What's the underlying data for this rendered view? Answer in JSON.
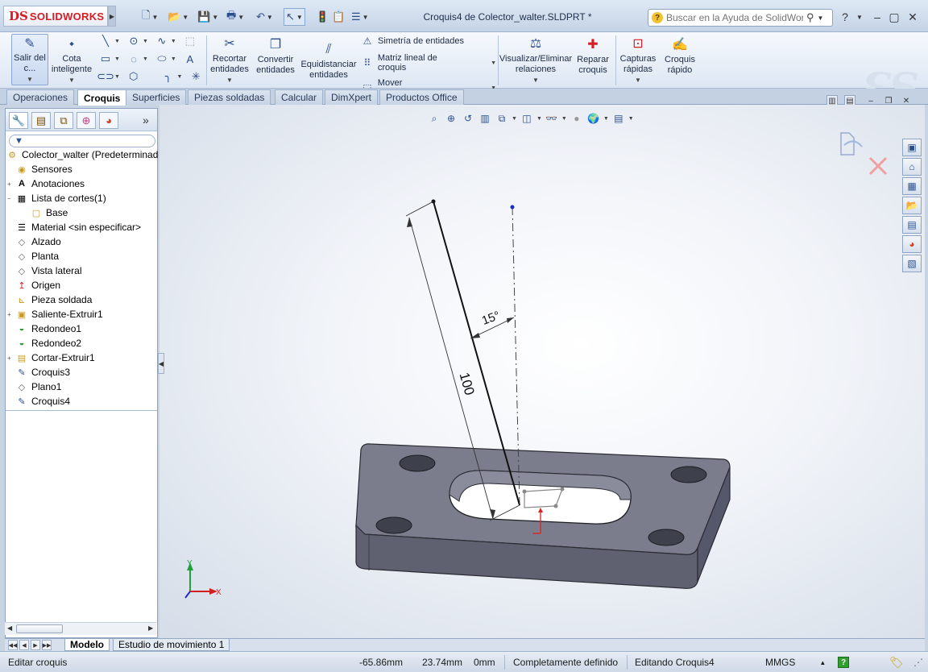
{
  "app": {
    "logo_symbol": "DS",
    "logo_text": "SOLIDWORKS",
    "document_title": "Croquis4 de Colector_walter.SLDPRT *",
    "search_placeholder": "Buscar en la Ayuda de SolidWorks"
  },
  "quick_access": [
    "new-icon",
    "open-icon",
    "save-icon",
    "print-icon",
    "undo-icon",
    "select-icon",
    "rebuild-icon",
    "file-properties-icon",
    "options-icon"
  ],
  "command_manager": {
    "exit_sketch": "Salir del c...",
    "smart_dimension": "Cota inteligente",
    "trim_entities": "Recortar entidades",
    "convert_entities": "Convertir entidades",
    "offset_entities": "Equidistanciar entidades",
    "mirror_entities": "Simetría de entidades",
    "linear_pattern": "Matriz lineal de croquis",
    "move_entities": "Mover entidades",
    "display_relations": "Visualizar/Eliminar relaciones",
    "repair_sketch": "Reparar croquis",
    "quick_snaps": "Capturas rápidas",
    "rapid_sketch": "Croquis rápido"
  },
  "tabs": [
    {
      "label": "Operaciones",
      "active": false
    },
    {
      "label": "Croquis",
      "active": true
    },
    {
      "label": "Superficies",
      "active": false
    },
    {
      "label": "Piezas soldadas",
      "active": false
    },
    {
      "label": "Calcular",
      "active": false
    },
    {
      "label": "DimXpert",
      "active": false
    },
    {
      "label": "Productos Office",
      "active": false
    }
  ],
  "tree": {
    "root": "Colector_walter  (Predeterminado",
    "items": [
      {
        "label": "Sensores",
        "icon": "sensor-icon"
      },
      {
        "label": "Anotaciones",
        "icon": "annotation-icon"
      },
      {
        "label": "Lista de cortes(1)",
        "icon": "cutlist-icon"
      },
      {
        "label": "Base",
        "icon": "body-icon"
      },
      {
        "label": "Material <sin especificar>",
        "icon": "material-icon"
      },
      {
        "label": "Alzado",
        "icon": "plane-icon"
      },
      {
        "label": "Planta",
        "icon": "plane-icon"
      },
      {
        "label": "Vista lateral",
        "icon": "plane-icon"
      },
      {
        "label": "Origen",
        "icon": "origin-icon"
      },
      {
        "label": "Pieza soldada",
        "icon": "weldment-icon"
      },
      {
        "label": "Saliente-Extruir1",
        "icon": "extrude-icon"
      },
      {
        "label": "Redondeo1",
        "icon": "fillet-icon"
      },
      {
        "label": "Redondeo2",
        "icon": "fillet-icon"
      },
      {
        "label": "Cortar-Extruir1",
        "icon": "cut-extrude-icon"
      },
      {
        "label": "Croquis3",
        "icon": "sketch-icon"
      },
      {
        "label": "Plano1",
        "icon": "plane-icon"
      },
      {
        "label": "Croquis4",
        "icon": "sketch-icon"
      }
    ]
  },
  "sketch": {
    "angle_label": "15°",
    "length_label": "100"
  },
  "triad": {
    "x": "X",
    "y": "Y"
  },
  "bottom_tabs": [
    {
      "label": "Modelo",
      "active": true
    },
    {
      "label": "Estudio de movimiento 1",
      "active": false
    }
  ],
  "status": {
    "message": "Editar croquis",
    "x": "-65.86mm",
    "y": "23.74mm",
    "z": "0mm",
    "definition": "Completamente definido",
    "editing": "Editando Croquis4",
    "units": "MMGS"
  },
  "colors": {
    "part_face": "#7b7d8c",
    "part_side": "#5f6170",
    "brand_red": "#d51e24",
    "accent": "#2a4f91"
  }
}
